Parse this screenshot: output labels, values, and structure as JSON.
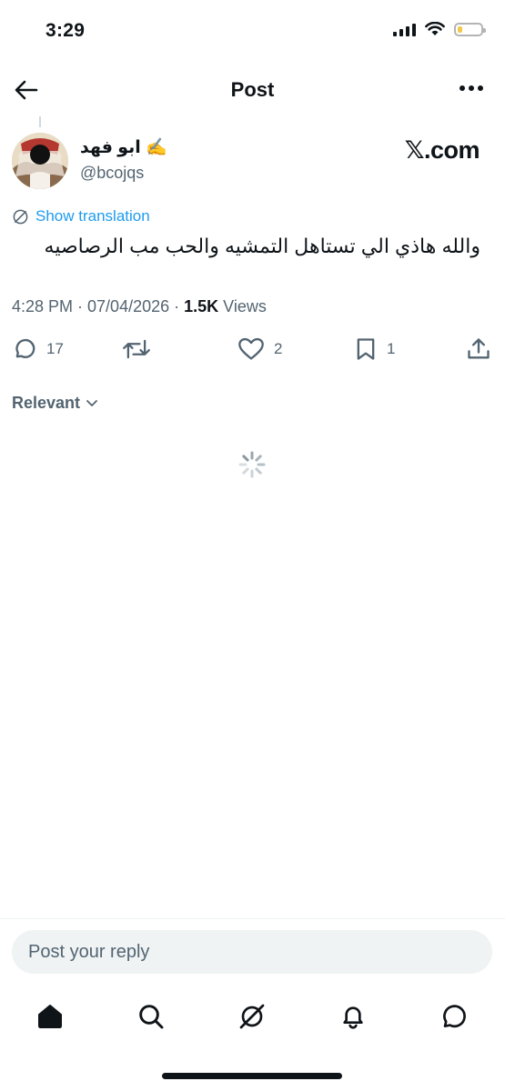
{
  "status_bar": {
    "time": "3:29",
    "icons": [
      "cellular-signal-icon",
      "wifi-icon",
      "battery-icon"
    ],
    "battery_fill": 0.2,
    "battery_color": "#f2c94c"
  },
  "header": {
    "title": "Post",
    "back_icon": "arrow-left-icon",
    "more_icon": "more-horizontal-icon"
  },
  "post": {
    "display_name": "ابو فهد ✍️",
    "handle": "@bcojqs",
    "brand": "𝕏.com",
    "show_translation": "Show translation",
    "text": "والله هاذي الي تستاهل التمشيه والحب مب الرصاصيه",
    "timestamp": "4:28 PM · 07/04/2026 · ",
    "views_count": "1.5K",
    "views_label": " Views",
    "actions": {
      "replies": "17",
      "reposts": "",
      "likes": "2",
      "bookmarks": "1"
    }
  },
  "replies_filter": {
    "label": "Relevant"
  },
  "reply_box": {
    "placeholder": "Post your reply"
  },
  "tab_bar": {
    "tabs": [
      "home-icon",
      "search-icon",
      "grok-icon",
      "notifications-icon",
      "messages-icon"
    ]
  },
  "colors": {
    "accent": "#1d9bf0",
    "text_primary": "#0f1419",
    "text_secondary": "#536471"
  }
}
